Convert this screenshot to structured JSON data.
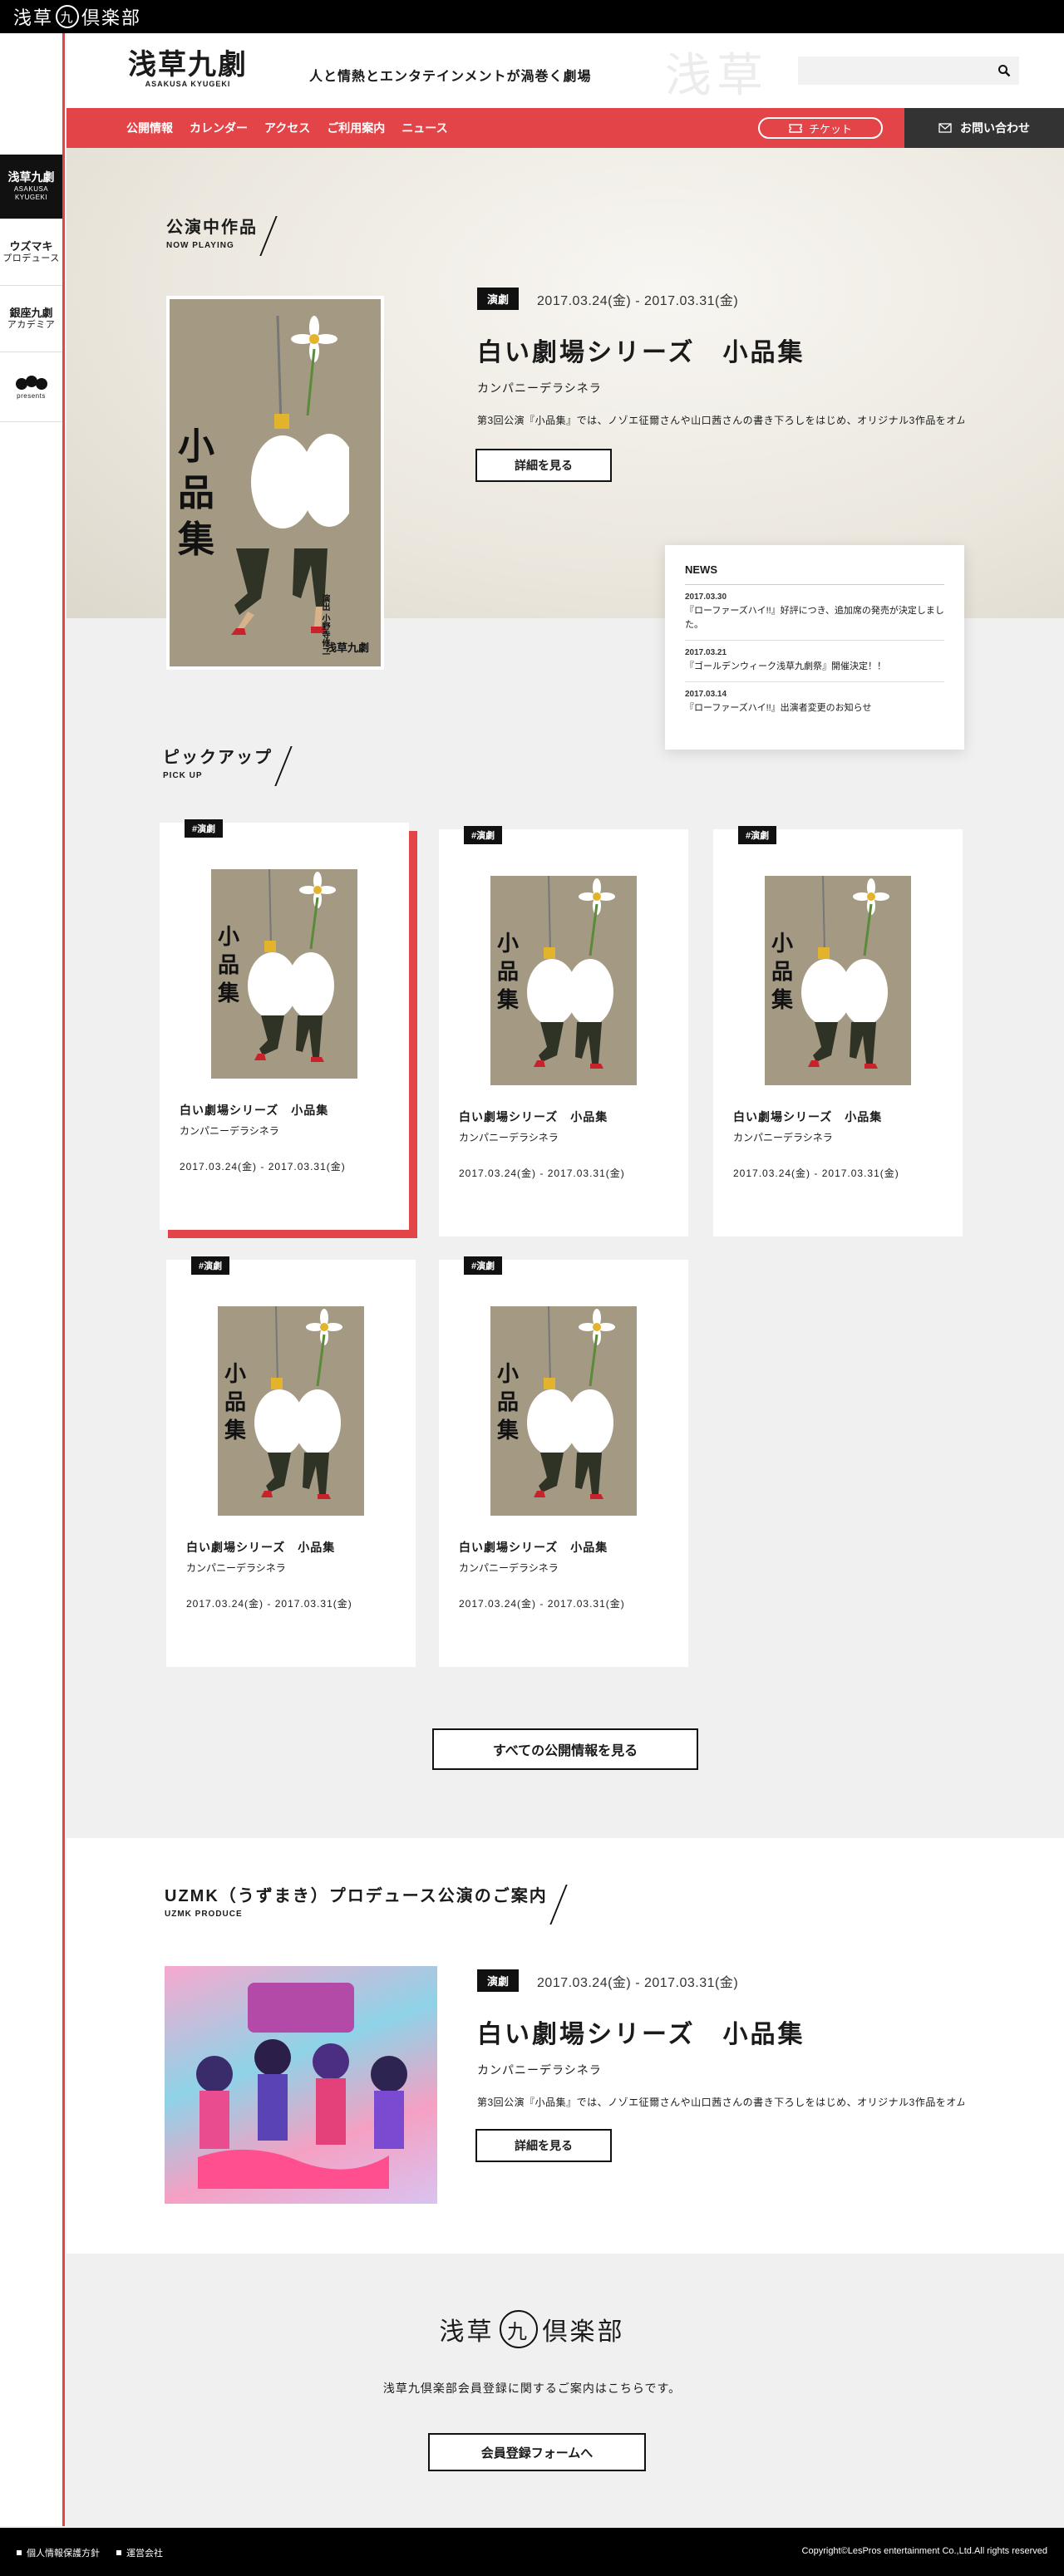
{
  "topbar": {
    "logo_left": "浅草",
    "logo_circle": "九",
    "logo_right": "倶楽部"
  },
  "leftrail": [
    {
      "label": "浅草九劇",
      "sub": "ASAKUSA KYUGEKI"
    },
    {
      "label": "ウズマキ",
      "sub": "プロデュース"
    },
    {
      "label": "銀座九劇",
      "sub": "アカデミア"
    },
    {
      "label": "WONDER KIDEMU",
      "sub": "presents"
    }
  ],
  "header": {
    "brand": "浅草九劇",
    "brand_en": "ASAKUSA KYUGEKI",
    "tagline": "人と情熱とエンタテインメントが渦巻く劇場",
    "deco": "浅草",
    "search_placeholder": ""
  },
  "nav": {
    "items": [
      "公開情報",
      "カレンダー",
      "アクセス",
      "ご利用案内",
      "ニュース"
    ],
    "ticket": "チケット",
    "contact": "お問い合わせ"
  },
  "now_playing": {
    "title_ja": "公演中作品",
    "title_en": "NOW PLAYING",
    "tag": "演劇",
    "date": "2017.03.24(金) - 2017.03.31(金)",
    "show": "白い劇場シリーズ　小品集",
    "company": "カンパニーデラシネラ",
    "desc": "第3回公演『小品集』では、ノゾエ征爾さんや山口茜さんの書き下ろしをはじめ、オリジナル3作品をオムニバ",
    "detail_btn": "詳細を見る"
  },
  "poster": {
    "big": "小品集",
    "sub": "SHOW HIN SHU",
    "credit": "浅草九劇",
    "director": "演出 小野寺修二"
  },
  "news": {
    "heading": "NEWS",
    "items": [
      {
        "date": "2017.03.30",
        "text": "『ローファーズハイ!!』好評につき、追加席の発売が決定しました。"
      },
      {
        "date": "2017.03.21",
        "text": "『ゴールデンウィーク浅草九劇祭』開催決定！！"
      },
      {
        "date": "2017.03.14",
        "text": "『ローファーズハイ!!』出演者変更のお知らせ"
      }
    ]
  },
  "pickup": {
    "title_ja": "ピックアップ",
    "title_en": "PICK UP",
    "cards": [
      {
        "tag": "#演劇",
        "title": "白い劇場シリーズ　小品集",
        "company": "カンパニーデラシネラ",
        "date": "2017.03.24(金) - 2017.03.31(金)"
      },
      {
        "tag": "#演劇",
        "title": "白い劇場シリーズ　小品集",
        "company": "カンパニーデラシネラ",
        "date": "2017.03.24(金) - 2017.03.31(金)"
      },
      {
        "tag": "#演劇",
        "title": "白い劇場シリーズ　小品集",
        "company": "カンパニーデラシネラ",
        "date": "2017.03.24(金) - 2017.03.31(金)"
      },
      {
        "tag": "#演劇",
        "title": "白い劇場シリーズ　小品集",
        "company": "カンパニーデラシネラ",
        "date": "2017.03.24(金) - 2017.03.31(金)"
      },
      {
        "tag": "#演劇",
        "title": "白い劇場シリーズ　小品集",
        "company": "カンパニーデラシネラ",
        "date": "2017.03.24(金) - 2017.03.31(金)"
      }
    ],
    "all_btn": "すべての公開情報を見る"
  },
  "uzmk": {
    "title_ja": "UZMK（うずまき）プロデュース公演のご案内",
    "title_en": "UZMK PRODUCE",
    "tag": "演劇",
    "date": "2017.03.24(金) - 2017.03.31(金)",
    "show": "白い劇場シリーズ　小品集",
    "company": "カンパニーデラシネラ",
    "desc": "第3回公演『小品集』では、ノゾエ征爾さんや山口茜さんの書き下ろしをはじめ、オリジナル3作品をオムニバ",
    "detail_btn": "詳細を見る"
  },
  "club": {
    "logo_left": "浅草",
    "logo_circle": "九",
    "logo_right": "倶楽部",
    "text": "浅草九倶楽部会員登録に関するご案内はこちらです。",
    "btn": "会員登録フォームへ"
  },
  "footer": {
    "privacy": "個人情報保護方針",
    "company": "運営会社",
    "copyright": "Copyright©LesPros entertainment Co.,Ltd.All rights reserved"
  }
}
